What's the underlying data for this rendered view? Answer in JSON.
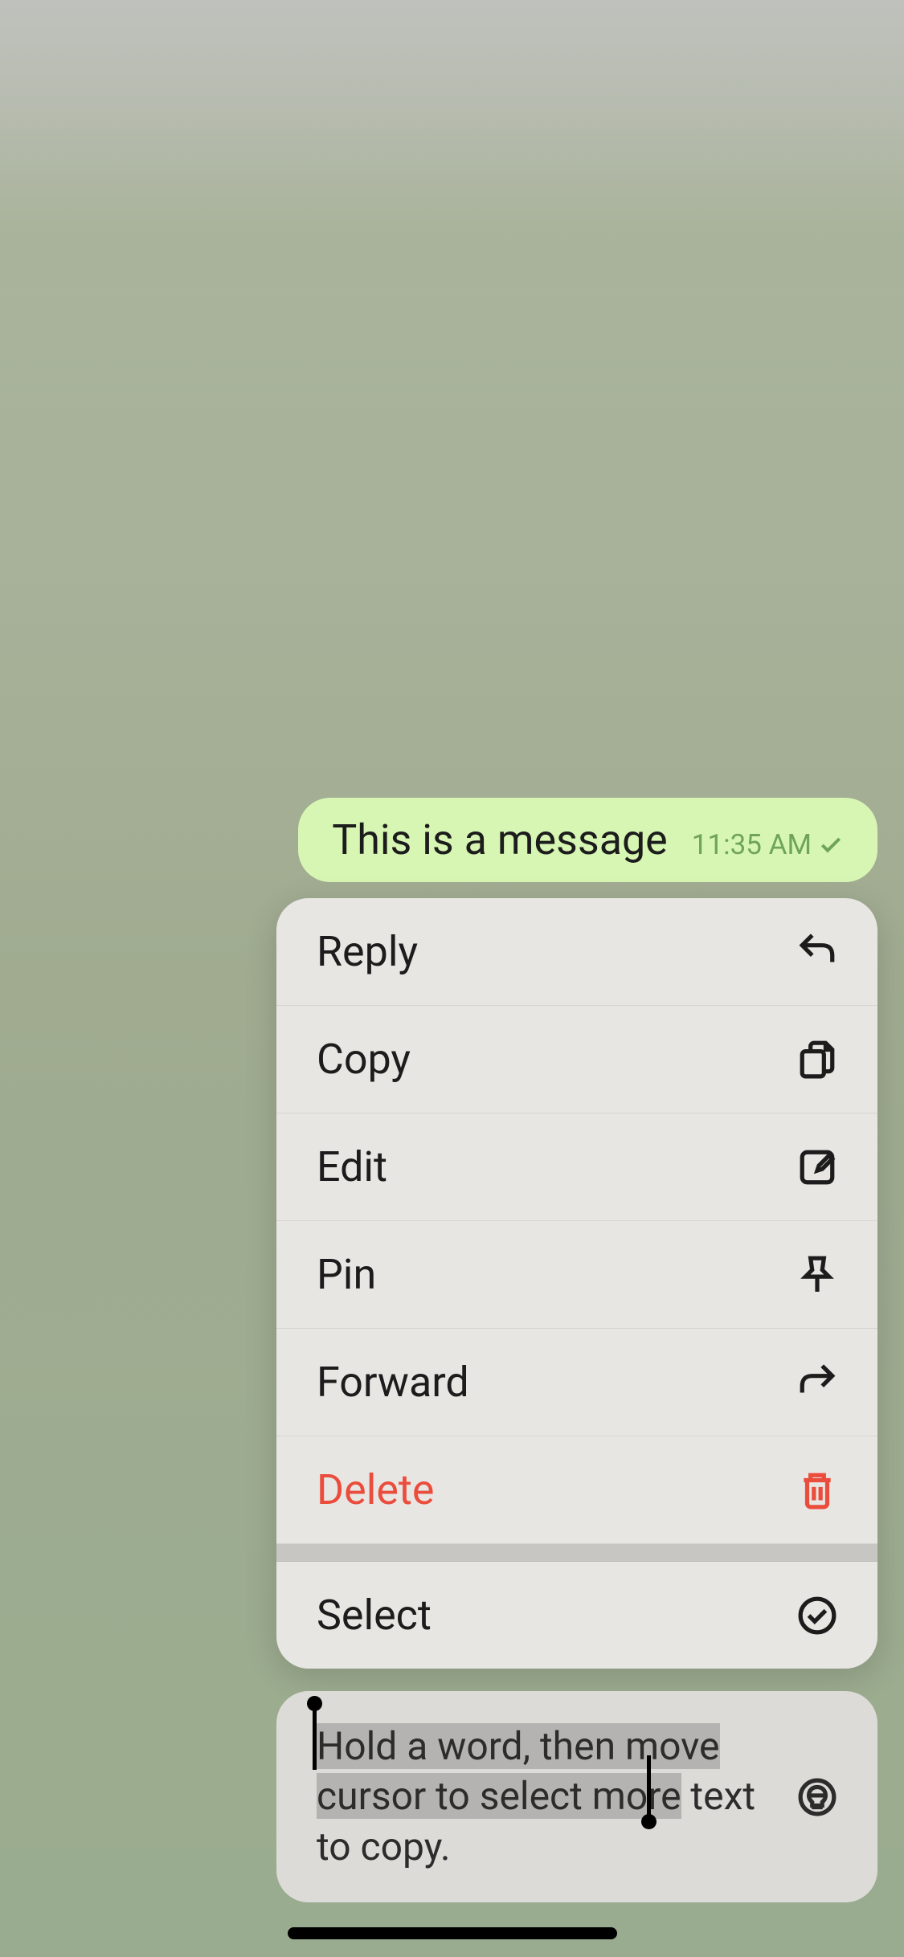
{
  "message": {
    "text": "This is a message",
    "time": "11:35 AM"
  },
  "menu": {
    "items": [
      {
        "label": "Reply",
        "icon": "reply",
        "destructive": false
      },
      {
        "label": "Copy",
        "icon": "copy",
        "destructive": false
      },
      {
        "label": "Edit",
        "icon": "edit",
        "destructive": false
      },
      {
        "label": "Pin",
        "icon": "pin",
        "destructive": false
      },
      {
        "label": "Forward",
        "icon": "forward",
        "destructive": false
      },
      {
        "label": "Delete",
        "icon": "trash",
        "destructive": true
      },
      {
        "separator": true
      },
      {
        "label": "Select",
        "icon": "select",
        "destructive": false
      }
    ]
  },
  "hint": {
    "highlighted": "Hold a word, then move cursor to select more",
    "plain_space": " ",
    "plain": "text to copy."
  }
}
